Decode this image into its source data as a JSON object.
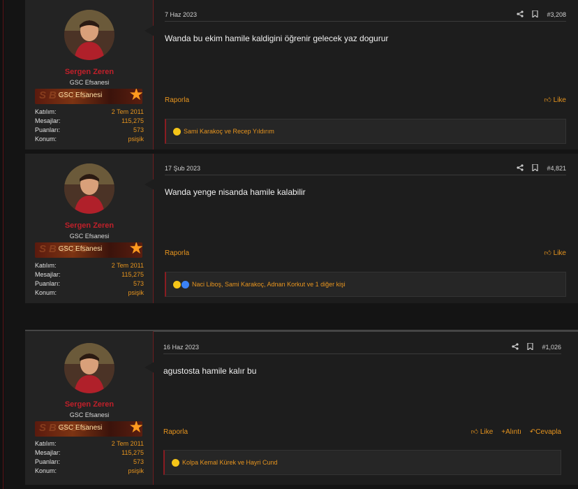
{
  "posts": [
    {
      "user": {
        "name": "Sergen Zeren",
        "title": "GSC Efsanesi",
        "banner": "GSC Efsanesi",
        "stats": [
          {
            "label": "Katılım:",
            "value": "2 Tem 2011"
          },
          {
            "label": "Mesajlar:",
            "value": "115,275"
          },
          {
            "label": "Puanları:",
            "value": "573"
          },
          {
            "label": "Konum:",
            "value": "psişik"
          }
        ]
      },
      "date": "7 Haz 2023",
      "number": "#3,208",
      "text": "Wanda bu ekim hamile kaldigini öğrenir gelecek yaz dogurur",
      "report": "Raporla",
      "like": "Like",
      "reactions": "Sami Karakoç ve Recep Yıldırım"
    },
    {
      "user": {
        "name": "Sergen Zeren",
        "title": "GSC Efsanesi",
        "banner": "GSC Efsanesi",
        "stats": [
          {
            "label": "Katılım:",
            "value": "2 Tem 2011"
          },
          {
            "label": "Mesajlar:",
            "value": "115,275"
          },
          {
            "label": "Puanları:",
            "value": "573"
          },
          {
            "label": "Konum:",
            "value": "psişik"
          }
        ]
      },
      "date": "17 Şub 2023",
      "number": "#4,821",
      "text": "Wanda yenge nisanda hamile kalabilir",
      "report": "Raporla",
      "like": "Like",
      "reactions": "Naci Liboş, Sami Karakoç, Adnan Korkut ve 1 diğer kişi"
    },
    {
      "user": {
        "name": "Sergen Zeren",
        "title": "GSC Efsanesi",
        "banner": "GSC Efsanesi",
        "stats": [
          {
            "label": "Katılım:",
            "value": "2 Tem 2011"
          },
          {
            "label": "Mesajlar:",
            "value": "115,275"
          },
          {
            "label": "Puanları:",
            "value": "573"
          },
          {
            "label": "Konum:",
            "value": "psişik"
          }
        ]
      },
      "date": "16 Haz 2023",
      "number": "#1,026",
      "text": "agustosta hamile kalır bu",
      "report": "Raporla",
      "like": "Like",
      "quote": "Alıntı",
      "reply": "Cevapla",
      "reactions": "Kolpa Kemal Kürek ve Hayri Cund"
    }
  ],
  "colors": {
    "accent": "#e8951e",
    "username": "#c0202a",
    "background": "#1d1d1d"
  }
}
